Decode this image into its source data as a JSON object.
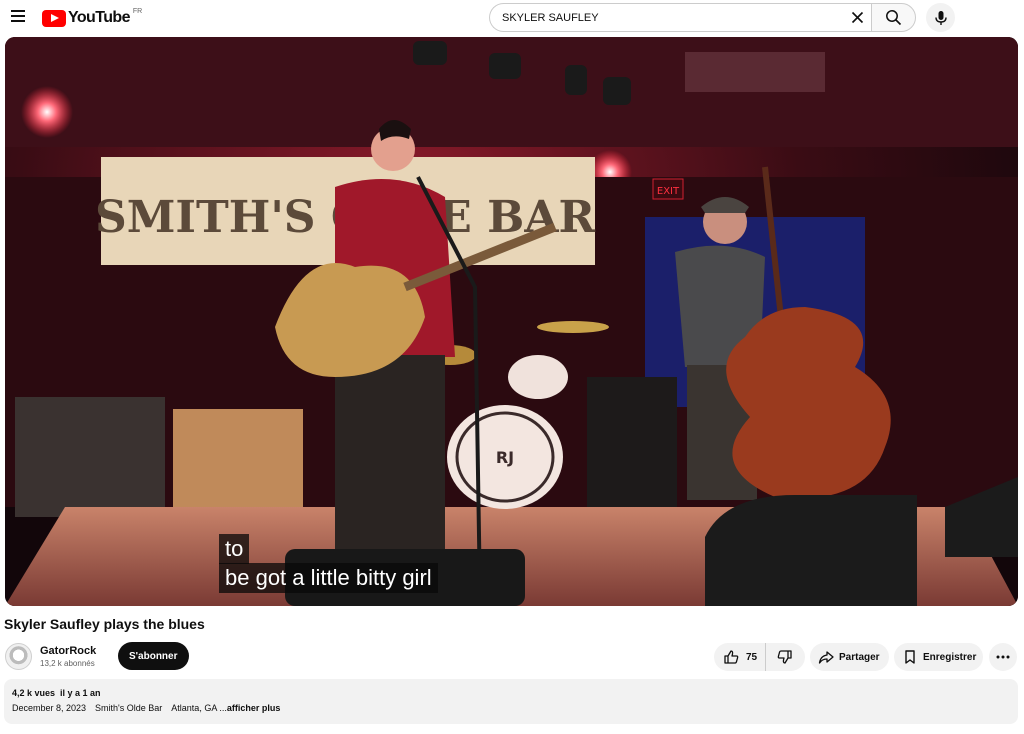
{
  "header": {
    "logo_text": "YouTube",
    "country_code": "FR",
    "search_value": "SKYLER SAUFLEY"
  },
  "video": {
    "captions": [
      "to",
      "be got a little bitty girl"
    ],
    "banner_text": "SMITH'S OLDE BAR",
    "exit_sign": "EXIT",
    "drum_text": "RJ",
    "title": "Skyler Saufley plays the blues"
  },
  "channel": {
    "name": "GatorRock",
    "subscribers": "13,2 k abonnés",
    "subscribe_label": "S'abonner"
  },
  "actions": {
    "like_count": "75",
    "share_label": "Partager",
    "save_label": "Enregistrer"
  },
  "description": {
    "views": "4,2 k vues",
    "age": "il y a 1 an",
    "date": "December 8, 2023",
    "venue": "Smith's Olde Bar",
    "location": "Atlanta, GA ...",
    "more_label": "afficher plus"
  },
  "colors": {
    "brand_red": "#ff0000",
    "stage_red": "#c8203a",
    "button_dark": "#0f0f0f",
    "chip_gray": "#f2f2f2"
  }
}
